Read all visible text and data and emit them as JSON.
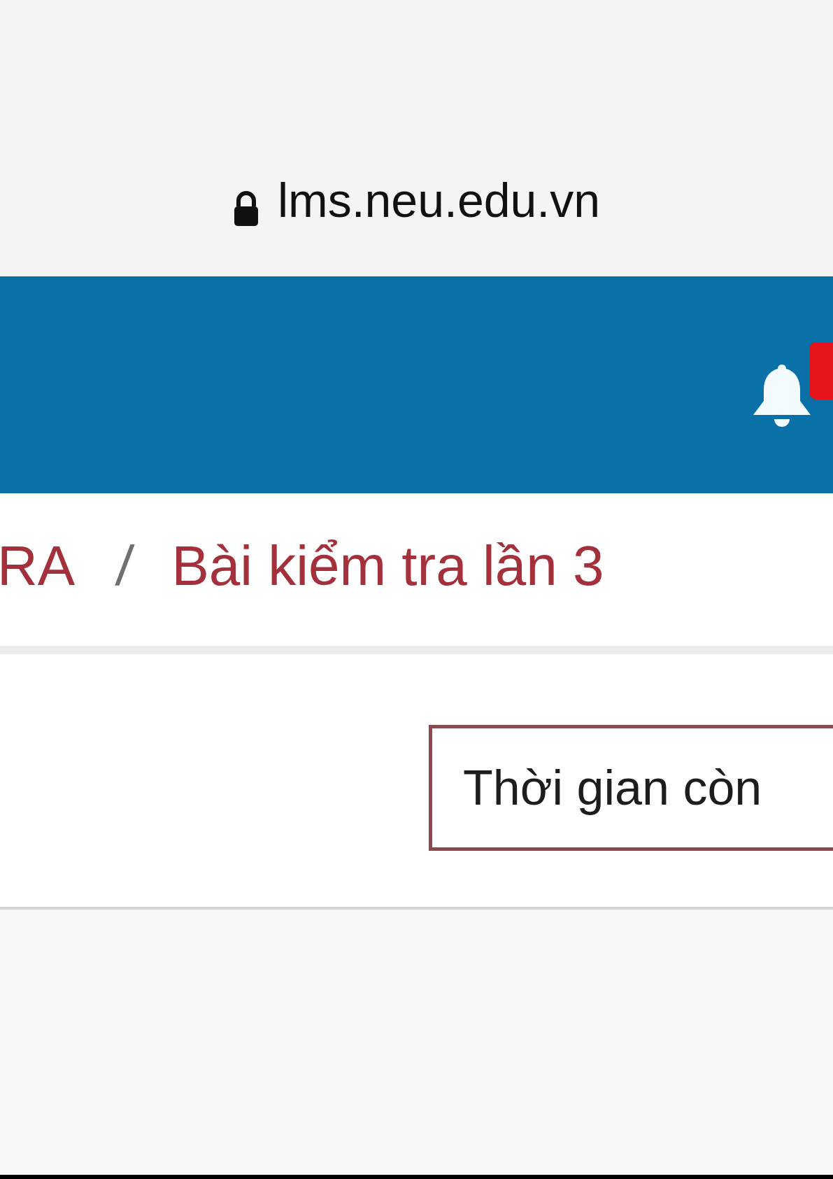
{
  "address_bar": {
    "url": "lms.neu.edu.vn",
    "secure": true
  },
  "header": {
    "notifications": {
      "unread": true
    }
  },
  "breadcrumb": [
    {
      "label": "RA"
    },
    {
      "label": "Bài kiểm tra lần 3"
    }
  ],
  "breadcrumb_separator": "/",
  "timer": {
    "label": "Thời gian còn"
  }
}
